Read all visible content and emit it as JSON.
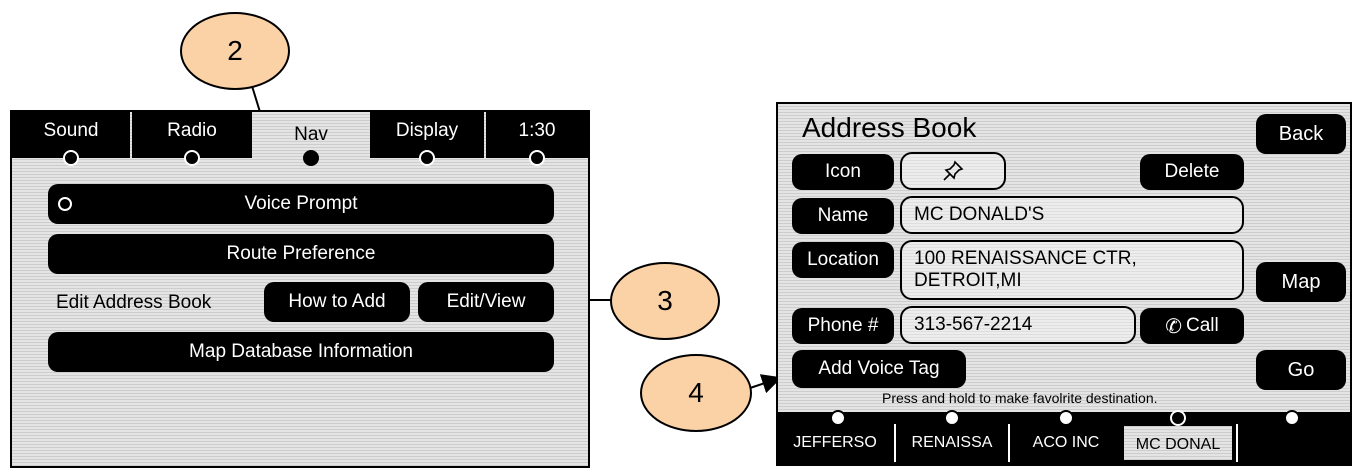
{
  "callouts": [
    "2",
    "3",
    "4"
  ],
  "left_screen": {
    "tabs": [
      {
        "label": "Sound",
        "active": false
      },
      {
        "label": "Radio",
        "active": false
      },
      {
        "label": "Nav",
        "active": true
      },
      {
        "label": "Display",
        "active": false
      },
      {
        "label": "1:30",
        "active": false
      }
    ],
    "voice_prompt": "Voice Prompt",
    "route_preference": "Route Preference",
    "edit_address_book_label": "Edit Address Book",
    "how_to_add": "How to Add",
    "edit_view": "Edit/View",
    "map_database_information": "Map Database Information"
  },
  "right_screen": {
    "title": "Address Book",
    "back": "Back",
    "icon_button": "Icon",
    "icon_value": "pushpin-icon",
    "delete": "Delete",
    "name_button": "Name",
    "name_value": "MC DONALD'S",
    "location_button": "Location",
    "location_line1": "100 RENAISSANCE CTR,",
    "location_line2": "DETROIT,MI",
    "map": "Map",
    "phone_button": "Phone #",
    "phone_value": "313-567-2214",
    "call": "Call",
    "add_voice_tag": "Add Voice Tag",
    "go": "Go",
    "hint": "Press and hold to make favolrite destination.",
    "entries": [
      {
        "label": "JEFFERSO",
        "active": false
      },
      {
        "label": "RENAISSA",
        "active": false
      },
      {
        "label": "ACO INC",
        "active": false
      },
      {
        "label": "MC DONAL",
        "active": true
      },
      {
        "label": "",
        "active": false
      }
    ]
  },
  "colors": {
    "callout": "#fbd1a6",
    "button": "#000000",
    "screen": "#e4e4e4"
  }
}
